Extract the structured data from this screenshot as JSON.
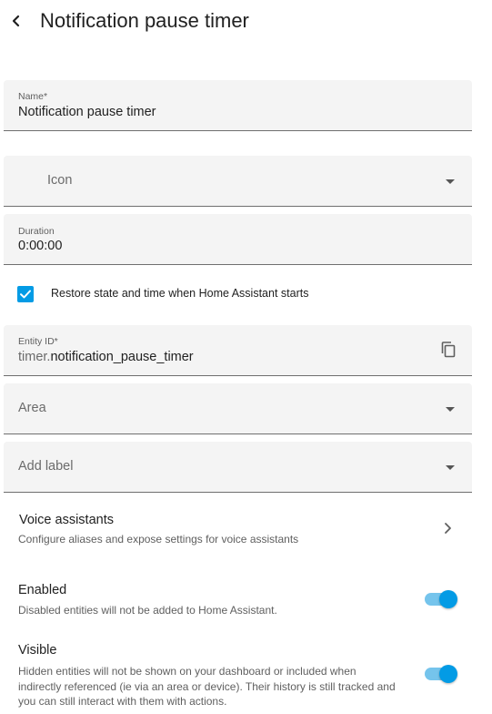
{
  "header": {
    "title": "Notification pause timer"
  },
  "form": {
    "name": {
      "label": "Name*",
      "value": "Notification pause timer"
    },
    "icon": {
      "placeholder": "Icon"
    },
    "duration": {
      "label": "Duration",
      "value": "0:00:00"
    },
    "restore": {
      "label": "Restore state and time when Home Assistant starts",
      "checked": true
    },
    "entity_id": {
      "label": "Entity ID*",
      "prefix": "timer.",
      "value": "notification_pause_timer"
    },
    "area": {
      "placeholder": "Area"
    },
    "label": {
      "placeholder": "Add label"
    }
  },
  "voice": {
    "title": "Voice assistants",
    "subtitle": "Configure aliases and expose settings for voice assistants"
  },
  "enabled": {
    "title": "Enabled",
    "subtitle": "Disabled entities will not be added to Home Assistant.",
    "on": true
  },
  "visible": {
    "title": "Visible",
    "subtitle": "Hidden entities will not be shown on your dashboard or included when indirectly referenced (ie via an area or device). Their history is still tracked and you can still interact with them with actions.",
    "on": true
  },
  "colors": {
    "accent": "#039be5",
    "accent_track": "#75c4ec",
    "field_bg": "#f4f4f4"
  }
}
